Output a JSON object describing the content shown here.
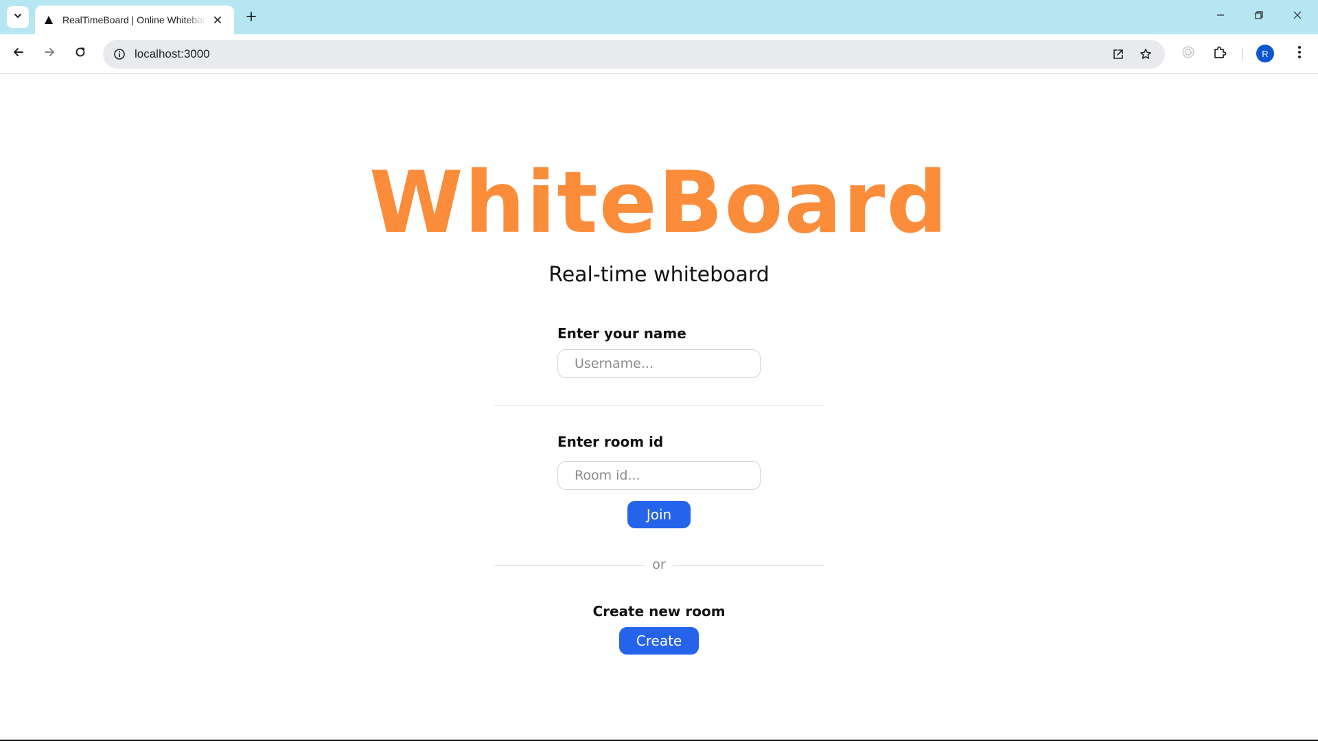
{
  "browser": {
    "tab_title": "RealTimeBoard | Online Whiteboard",
    "url": "localhost:3000",
    "profile_initial": "R"
  },
  "page": {
    "brand": "WhiteBoard",
    "subtitle": "Real-time whiteboard",
    "name_label": "Enter your name",
    "name_placeholder": "Username...",
    "room_label": "Enter room id",
    "room_placeholder": "Room id...",
    "join_label": "Join",
    "or_text": "or",
    "create_label": "Create new room",
    "create_button": "Create"
  },
  "colors": {
    "brand": "#fb8c3a",
    "button": "#2563eb",
    "tabbar": "#b6e6f1"
  }
}
